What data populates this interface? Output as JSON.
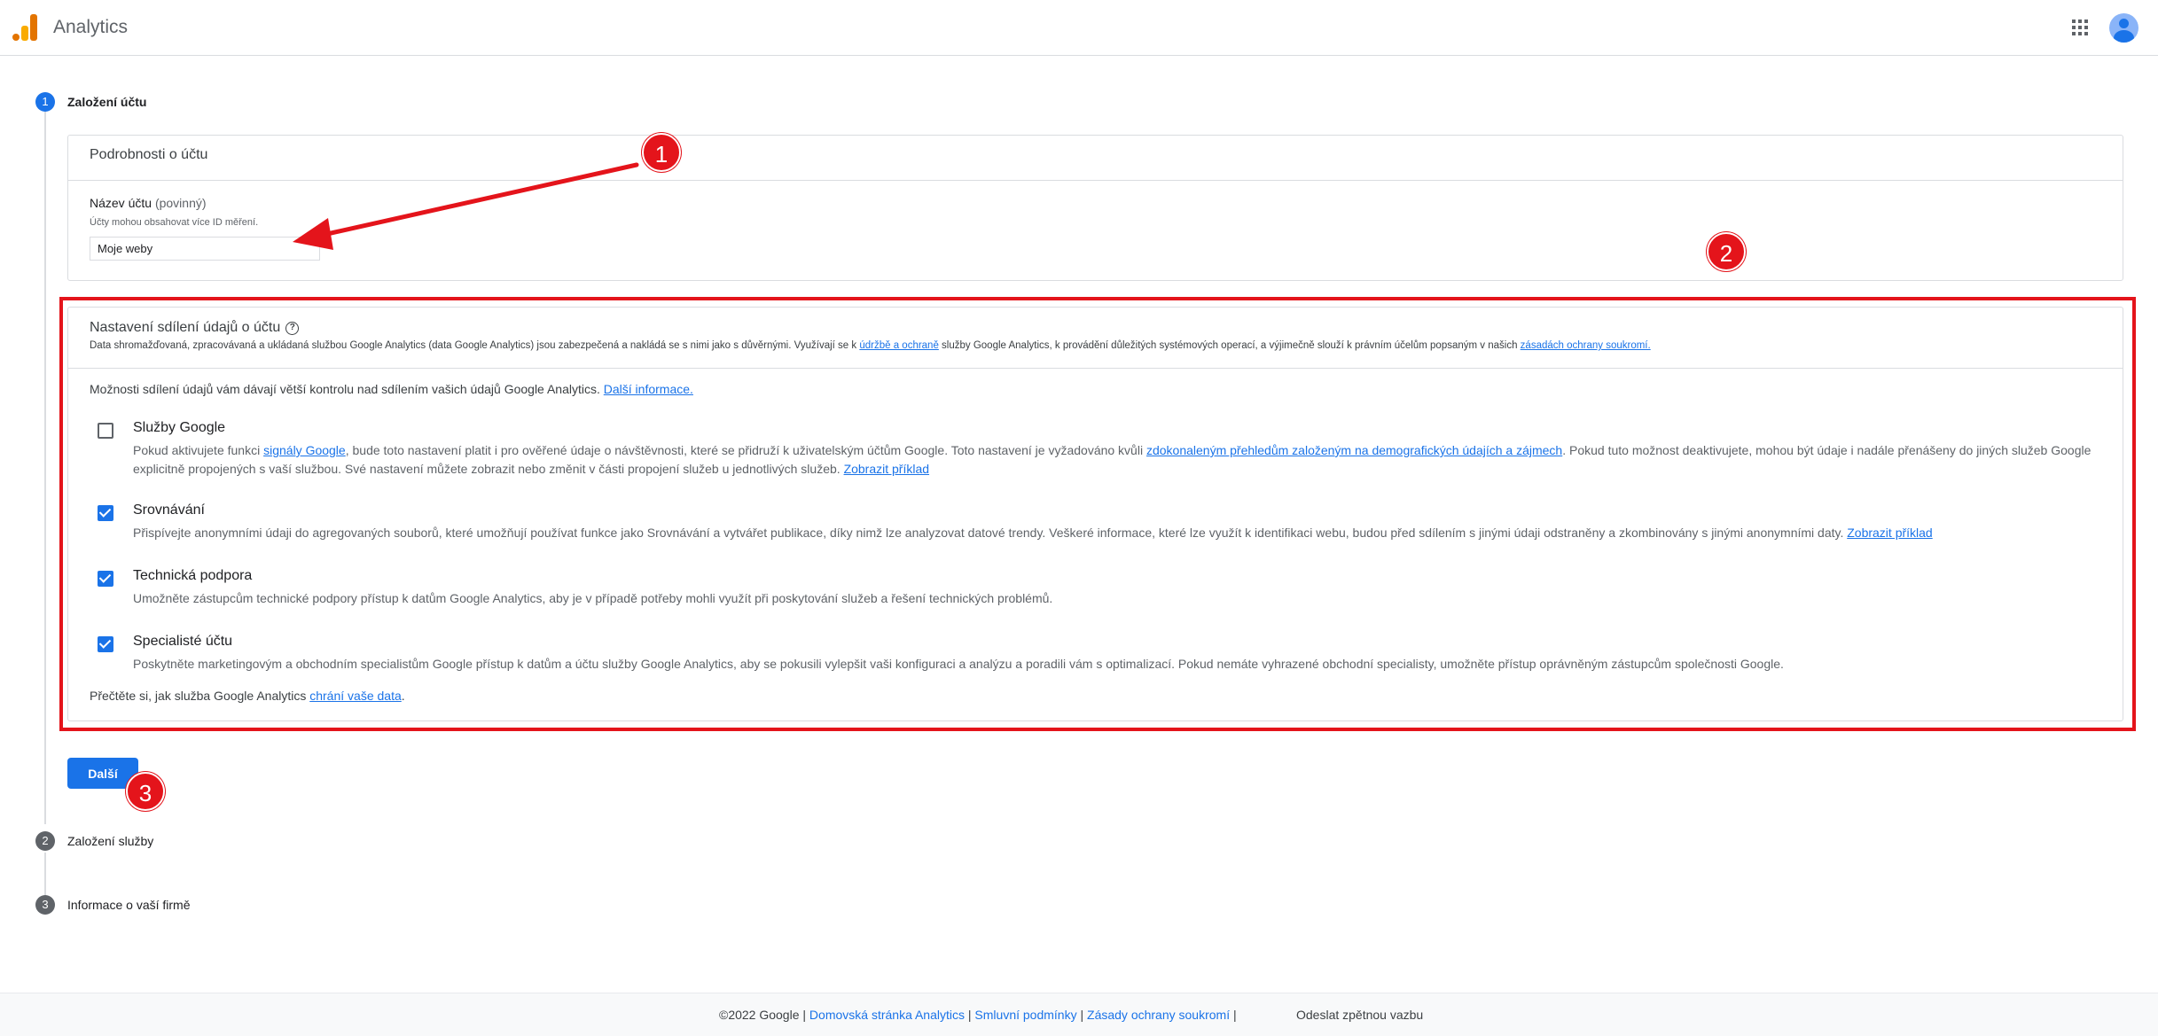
{
  "header": {
    "app_title": "Analytics"
  },
  "steps": [
    {
      "number": "1",
      "label": "Založení účtu"
    },
    {
      "number": "2",
      "label": "Založení služby"
    },
    {
      "number": "3",
      "label": "Informace o vaší firmě"
    }
  ],
  "account_details": {
    "section_title": "Podrobnosti o účtu",
    "field_label": "Název účtu",
    "field_required": "(povinný)",
    "field_help": "Účty mohou obsahovat více ID měření.",
    "field_value": "Moje weby"
  },
  "sharing": {
    "title": "Nastavení sdílení údajů o účtu",
    "desc_part1": "Data shromažďovaná, zpracovávaná a ukládaná službou Google Analytics (data Google Analytics) jsou zabezpečená a nakládá se s nimi jako s důvěrnými. Využívají se k ",
    "desc_link1": "údržbě a ochraně",
    "desc_part2": " služby Google Analytics, k provádění důležitých systémových operací, a výjimečně slouží k právním účelům popsaným v našich ",
    "desc_link2": "zásadách ochrany soukromí.",
    "intro_text": "Možnosti sdílení údajů vám dávají větší kontrolu nad sdílením vašich údajů Google Analytics. ",
    "intro_link": "Další informace.",
    "options": [
      {
        "title": "Služby Google",
        "checked": false,
        "desc_part1": "Pokud aktivujete funkci ",
        "desc_link1": "signály Google",
        "desc_part2": ", bude toto nastavení platit i pro ověřené údaje o návštěvnosti, které se přidruží k uživatelským účtům Google. Toto nastavení je vyžadováno kvůli ",
        "desc_link2": "zdokonaleným přehledům založeným na demografických údajích a zájmech",
        "desc_part3": ". Pokud tuto možnost deaktivujete, mohou být údaje i nadále přenášeny do jiných služeb Google explicitně propojených s vaší službou. Své nastavení můžete zobrazit nebo změnit v části propojení služeb u jednotlivých služeb.  ",
        "example_link": "Zobrazit příklad"
      },
      {
        "title": "Srovnávání",
        "checked": true,
        "desc": "Přispívejte anonymními údaji do agregovaných souborů, které umožňují používat funkce jako Srovnávání a vytvářet publikace, díky nimž lze analyzovat datové trendy. Veškeré informace, které lze využít k identifikaci webu, budou před sdílením s jinými údaji odstraněny a zkombinovány s jinými anonymními daty.  ",
        "example_link": "Zobrazit příklad"
      },
      {
        "title": "Technická podpora",
        "checked": true,
        "desc": "Umožněte zástupcům technické podpory přístup k datům Google Analytics, aby je v případě potřeby mohli využít při poskytování služeb a řešení technických problémů."
      },
      {
        "title": "Specialisté účtu",
        "checked": true,
        "desc": "Poskytněte marketingovým a obchodním specialistům Google přístup k datům a účtu služby Google Analytics, aby se pokusili vylepšit vaši konfiguraci a analýzu a poradili vám s optimalizací. Pokud nemáte vyhrazené obchodní specialisty, umožněte přístup oprávněným zástupcům společnosti Google."
      }
    ],
    "footer_text": "Přečtěte si, jak služba Google Analytics ",
    "footer_link": "chrání vaše data",
    "footer_end": "."
  },
  "next_button": "Další",
  "annotations": [
    "1",
    "2",
    "3"
  ],
  "colors": {
    "accent": "#1a73e8",
    "annotation_red": "#e4141b"
  },
  "footer": {
    "copyright": "©2022 Google",
    "sep": " | ",
    "link1": "Domovská stránka Analytics",
    "link2": "Smluvní podmínky",
    "link3": "Zásady ochrany soukromí",
    "end_sep": " |",
    "feedback": "Odeslat zpětnou vazbu"
  }
}
